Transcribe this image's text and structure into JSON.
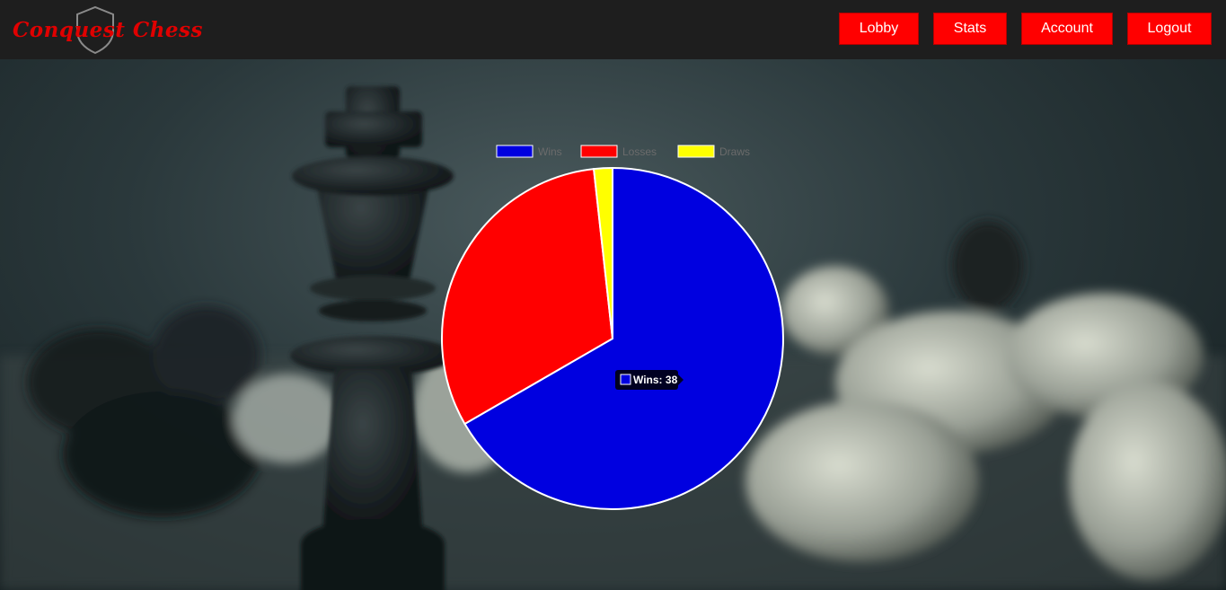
{
  "app": {
    "logo_text": "Conquest Chess"
  },
  "nav": {
    "items": [
      {
        "label": "Lobby"
      },
      {
        "label": "Stats"
      },
      {
        "label": "Account"
      },
      {
        "label": "Logout"
      }
    ]
  },
  "colors": {
    "nav_background": "#1e1e1e",
    "accent": "#ff0000"
  },
  "chart_data": {
    "type": "pie",
    "categories": [
      "Wins",
      "Losses",
      "Draws"
    ],
    "values": [
      38,
      18,
      1
    ],
    "colors": [
      "#0000e0",
      "#ff0000",
      "#ffff00"
    ],
    "legend_position": "top",
    "tooltip": {
      "label": "Wins",
      "value": 38
    }
  }
}
